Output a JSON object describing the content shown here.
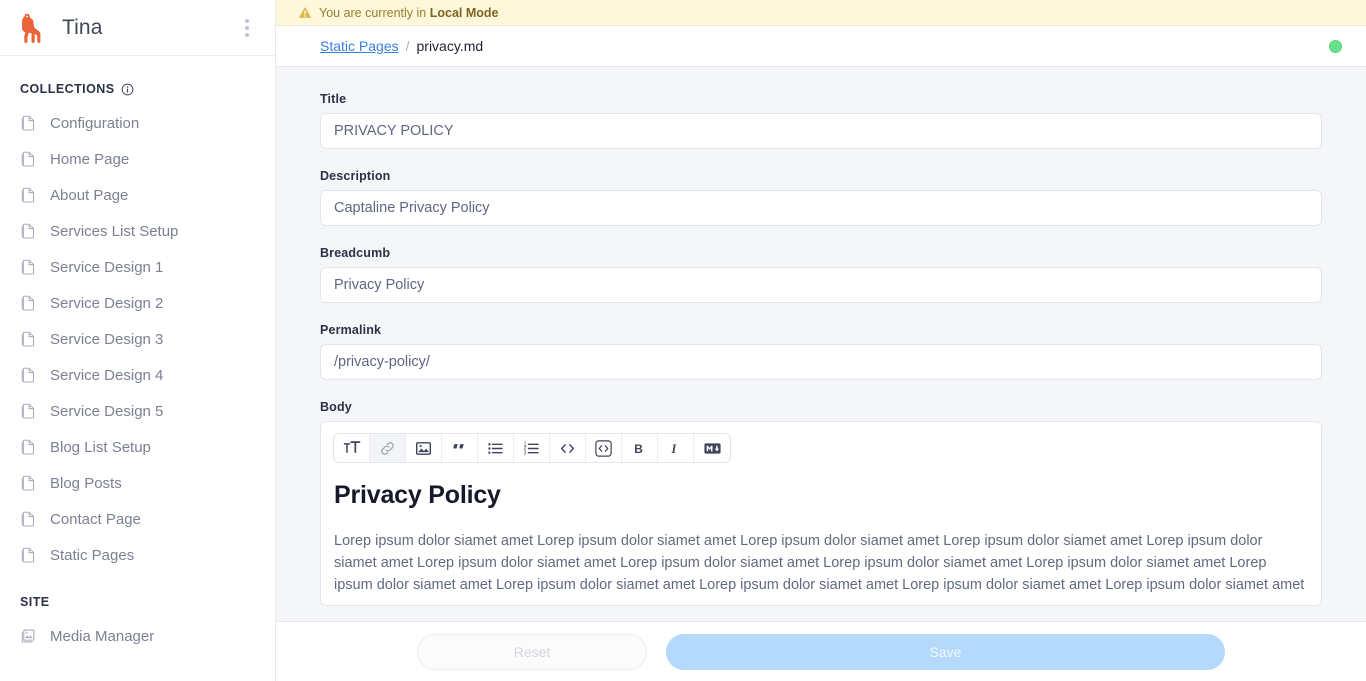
{
  "sidebar": {
    "brand": {
      "name": "Tina",
      "logo_icon": "llama-icon",
      "menu_icon": "kebab-menu-icon"
    },
    "collections_heading": "COLLECTIONS",
    "collections_info_icon": "info-circle-icon",
    "collections": [
      {
        "label": "Configuration",
        "icon": "document-icon"
      },
      {
        "label": "Home Page",
        "icon": "document-icon"
      },
      {
        "label": "About Page",
        "icon": "document-icon"
      },
      {
        "label": "Services List Setup",
        "icon": "document-icon"
      },
      {
        "label": "Service Design 1",
        "icon": "document-icon"
      },
      {
        "label": "Service Design 2",
        "icon": "document-icon"
      },
      {
        "label": "Service Design 3",
        "icon": "document-icon"
      },
      {
        "label": "Service Design 4",
        "icon": "document-icon"
      },
      {
        "label": "Service Design 5",
        "icon": "document-icon"
      },
      {
        "label": "Blog List Setup",
        "icon": "document-icon"
      },
      {
        "label": "Blog Posts",
        "icon": "document-icon"
      },
      {
        "label": "Contact Page",
        "icon": "document-icon"
      },
      {
        "label": "Static Pages",
        "icon": "document-icon"
      }
    ],
    "site_heading": "SITE",
    "site_items": [
      {
        "label": "Media Manager",
        "icon": "media-image-icon"
      }
    ]
  },
  "notice": {
    "icon": "warning-triangle-icon",
    "text_prefix": "You are currently in ",
    "text_strong": "Local Mode"
  },
  "breadcrumb": {
    "parent": "Static Pages",
    "separator": "/",
    "current": "privacy.md",
    "status_icon": "status-dot-green"
  },
  "form": {
    "fields": [
      {
        "label": "Title",
        "value": "PRIVACY POLICY",
        "placeholder": ""
      },
      {
        "label": "Description",
        "value": "Captaline Privacy Policy",
        "placeholder": ""
      },
      {
        "label": "Breadcumb",
        "value": "Privacy Policy",
        "placeholder": ""
      },
      {
        "label": "Permalink",
        "value": "/privacy-policy/",
        "placeholder": ""
      }
    ],
    "body": {
      "label": "Body",
      "toolbar": [
        {
          "name": "heading-text-size-icon",
          "title": "Heading",
          "disabled": false
        },
        {
          "name": "link-icon",
          "title": "Link",
          "disabled": true
        },
        {
          "name": "image-icon",
          "title": "Image",
          "disabled": false
        },
        {
          "name": "quote-icon",
          "title": "Quote",
          "disabled": false
        },
        {
          "name": "bulleted-list-icon",
          "title": "Bulleted List",
          "disabled": false
        },
        {
          "name": "numbered-list-icon",
          "title": "Numbered List",
          "disabled": false
        },
        {
          "name": "inline-code-icon",
          "title": "Code",
          "disabled": false
        },
        {
          "name": "code-block-icon",
          "title": "Code Block",
          "disabled": false
        },
        {
          "name": "bold-icon",
          "title": "Bold",
          "disabled": false
        },
        {
          "name": "italic-icon",
          "title": "Italic",
          "disabled": false
        },
        {
          "name": "markdown-icon",
          "title": "Raw Markdown",
          "disabled": false
        }
      ],
      "heading": "Privacy Policy",
      "paragraph": "Lorep ipsum dolor siamet amet Lorep ipsum dolor siamet amet Lorep ipsum dolor siamet amet Lorep ipsum dolor siamet amet Lorep ipsum dolor siamet amet Lorep ipsum dolor siamet amet Lorep ipsum dolor siamet amet Lorep ipsum dolor siamet amet Lorep ipsum dolor siamet amet Lorep ipsum dolor siamet amet Lorep ipsum dolor siamet amet Lorep ipsum dolor siamet amet Lorep ipsum dolor siamet amet Lorep ipsum dolor siamet amet"
    }
  },
  "footer": {
    "reset_label": "Reset",
    "save_label": "Save"
  },
  "colors": {
    "brand_orange": "#eb6337",
    "link_blue": "#3b7fe0",
    "save_blue": "#b4d9fb",
    "notice_bg": "#fdf8dc",
    "notice_text": "#9a7d2e",
    "status_green": "#67e28d",
    "page_bg": "#f5f6f8"
  }
}
